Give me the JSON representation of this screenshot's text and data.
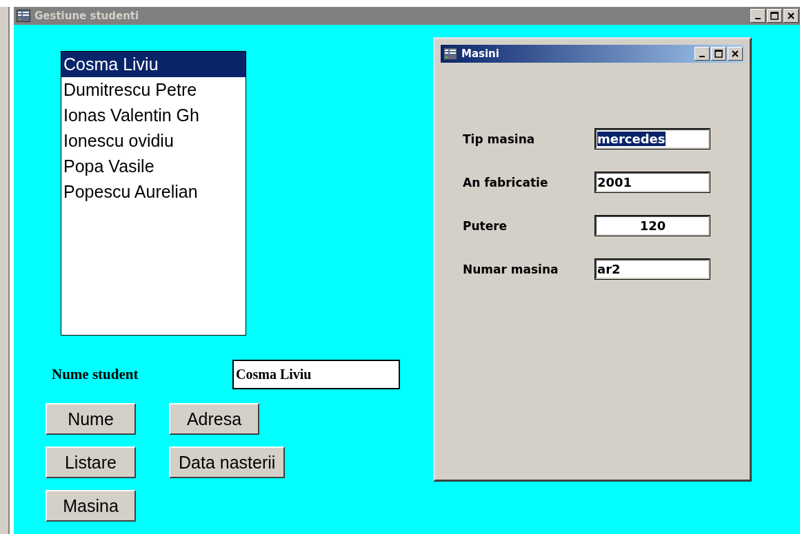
{
  "main_window": {
    "title": "Gestiune studenti",
    "active": false
  },
  "students": [
    {
      "name": "Cosma Liviu",
      "selected": true
    },
    {
      "name": "Dumitrescu Petre",
      "selected": false
    },
    {
      "name": "Ionas Valentin Gh",
      "selected": false
    },
    {
      "name": "Ionescu ovidiu",
      "selected": false
    },
    {
      "name": "Popa Vasile",
      "selected": false
    },
    {
      "name": "Popescu Aurelian",
      "selected": false
    }
  ],
  "student_field": {
    "label": "Nume student",
    "value": "Cosma Liviu"
  },
  "buttons": [
    [
      "Nume",
      "Adresa"
    ],
    [
      "Listare",
      "Data nasterii"
    ],
    [
      "Masina"
    ]
  ],
  "car_window": {
    "title": "Masini",
    "active": true,
    "fields": [
      {
        "label": "Tip masina",
        "value": "mercedes",
        "highlighted": true,
        "centered": false
      },
      {
        "label": "An fabricatie",
        "value": "2001",
        "highlighted": false,
        "centered": false
      },
      {
        "label": "Putere",
        "value": "120",
        "highlighted": false,
        "centered": true
      },
      {
        "label": "Numar masina",
        "value": "ar2",
        "highlighted": false,
        "centered": false
      }
    ]
  }
}
